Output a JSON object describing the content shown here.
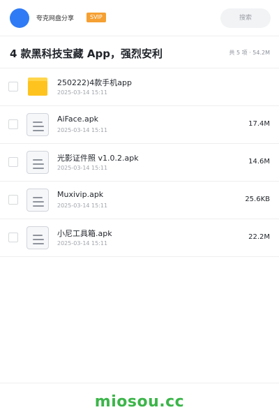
{
  "header": {
    "user_name": "夸克网盘分享",
    "badge": "SVIP",
    "search_placeholder": "搜索"
  },
  "share": {
    "title": "4 款黑科技宝藏 App，强烈安利",
    "summary": "共 5 项 · 54.2M"
  },
  "files": [
    {
      "name": "250222)4款手机app",
      "date": "2025-03-14 15:11",
      "size": "",
      "type": "folder"
    },
    {
      "name": "AiFace.apk",
      "date": "2025-03-14 15:11",
      "size": "17.4M",
      "type": "file"
    },
    {
      "name": "光影证件照 v1.0.2.apk",
      "date": "2025-03-14 15:11",
      "size": "14.6M",
      "type": "file"
    },
    {
      "name": "Muxivip.apk",
      "date": "2025-03-14 15:11",
      "size": "25.6KB",
      "type": "file"
    },
    {
      "name": "小尼工具箱.apk",
      "date": "2025-03-14 15:11",
      "size": "22.2M",
      "type": "file"
    }
  ],
  "footer": {
    "watermark": "miosou.cc"
  },
  "colors": {
    "avatar": "#2f7bf5",
    "svip_badge": "#f5a032",
    "folder": "#ffc31f",
    "watermark": "#3cb54a"
  }
}
